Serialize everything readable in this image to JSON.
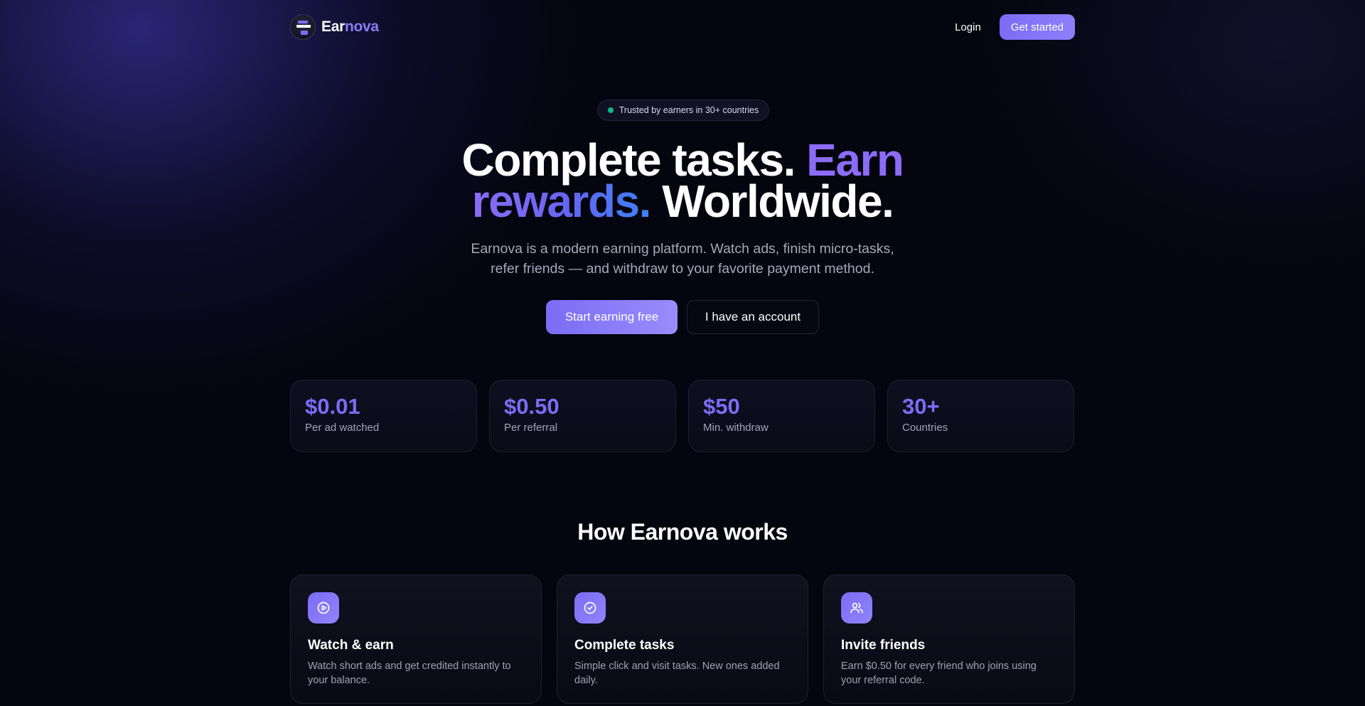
{
  "nav": {
    "brand_part1": "Ear",
    "brand_part2": "nova",
    "login": "Login",
    "get_started": "Get started"
  },
  "hero": {
    "badge": "Trusted by earners in 30+ countries",
    "title_line1_a": "Complete tasks. ",
    "title_line1_b": "Earn",
    "title_line2_a": "rewards.",
    "title_line2_b": " Worldwide.",
    "subtitle": "Earnova is a modern earning platform. Watch ads, finish micro-tasks, refer friends — and withdraw to your favorite payment method.",
    "cta_primary": "Start earning free",
    "cta_secondary": "I have an account"
  },
  "stats": [
    {
      "value": "$0.01",
      "label": "Per ad watched"
    },
    {
      "value": "$0.50",
      "label": "Per referral"
    },
    {
      "value": "$50",
      "label": "Min. withdraw"
    },
    {
      "value": "30+",
      "label": "Countries"
    }
  ],
  "how": {
    "title": "How Earnova works",
    "features": [
      {
        "icon": "play-circle-icon",
        "title": "Watch & earn",
        "desc": "Watch short ads and get credited instantly to your balance."
      },
      {
        "icon": "check-circle-icon",
        "title": "Complete tasks",
        "desc": "Simple click and visit tasks. New ones added daily."
      },
      {
        "icon": "users-icon",
        "title": "Invite friends",
        "desc": "Earn $0.50 for every friend who joins using your referral code."
      }
    ]
  },
  "colors": {
    "accent": "#7c6cf6",
    "background": "#05050f",
    "status_dot": "#10b981"
  }
}
